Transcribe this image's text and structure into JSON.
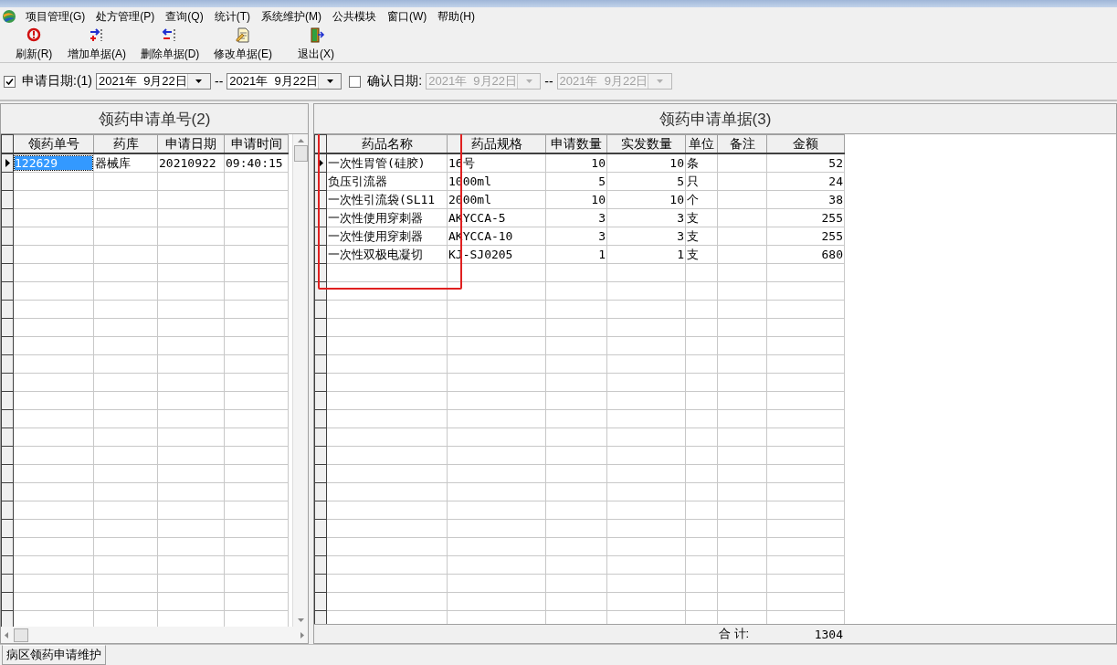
{
  "menu": [
    {
      "label": "项目管理(G)"
    },
    {
      "label": "处方管理(P)"
    },
    {
      "label": "查询(Q)"
    },
    {
      "label": "统计(T)"
    },
    {
      "label": "系统维护(M)"
    },
    {
      "label": "公共模块"
    },
    {
      "label": "窗口(W)"
    },
    {
      "label": "帮助(H)"
    }
  ],
  "toolbar": [
    {
      "kind": "refresh",
      "label": "刷新(R)"
    },
    {
      "kind": "add",
      "label": "增加单据(A)"
    },
    {
      "kind": "delete",
      "label": "删除单据(D)"
    },
    {
      "kind": "edit",
      "label": "修改单据(E)"
    },
    {
      "kind": "exit",
      "label": "退出(X)"
    }
  ],
  "filters": [
    {
      "checked": true,
      "label": "申请日期:(1)",
      "from": "2021年  9月22日",
      "to": "2021年  9月22日",
      "disabled": false,
      "separator": "--"
    },
    {
      "checked": false,
      "label": "确认日期:",
      "from": "2021年  9月22日",
      "to": "2021年  9月22日",
      "disabled": true,
      "separator": "--"
    }
  ],
  "left_panel": {
    "title": "领药申请单号(2)",
    "columns": [
      "领药单号",
      "药库",
      "申请日期",
      "申请时间"
    ],
    "rows": [
      {
        "selected": true,
        "cells": [
          "122629",
          "器械库",
          "20210922",
          "09:40:15"
        ]
      }
    ]
  },
  "right_panel": {
    "title": "领药申请单据(3)",
    "columns": [
      "药品名称",
      "药品规格",
      "申请数量",
      "实发数量",
      "单位",
      "备注",
      "金额"
    ],
    "rows": [
      {
        "selected": true,
        "cells": [
          "一次性胃管(硅胶)",
          "16号",
          "10",
          "10",
          "条",
          "",
          "52"
        ]
      },
      {
        "selected": false,
        "cells": [
          "负压引流器",
          "1000ml",
          "5",
          "5",
          "只",
          "",
          "24"
        ]
      },
      {
        "selected": false,
        "cells": [
          "一次性引流袋(SL11",
          "2000ml",
          "10",
          "10",
          "个",
          "",
          "38"
        ]
      },
      {
        "selected": false,
        "cells": [
          "一次性使用穿刺器",
          "AKYCCA-5",
          "3",
          "3",
          "支",
          "",
          "255"
        ]
      },
      {
        "selected": false,
        "cells": [
          "一次性使用穿刺器",
          "AKYCCA-10",
          "3",
          "3",
          "支",
          "",
          "255"
        ]
      },
      {
        "selected": false,
        "cells": [
          "一次性双极电凝切",
          "KJ-SJ0205",
          "1",
          "1",
          "支",
          "",
          "680"
        ]
      }
    ],
    "total_label": "合 计:",
    "total": "1304"
  },
  "annotation": {
    "kind": "rectangle"
  },
  "status_bar": {
    "text": "病区领药申请维护"
  }
}
